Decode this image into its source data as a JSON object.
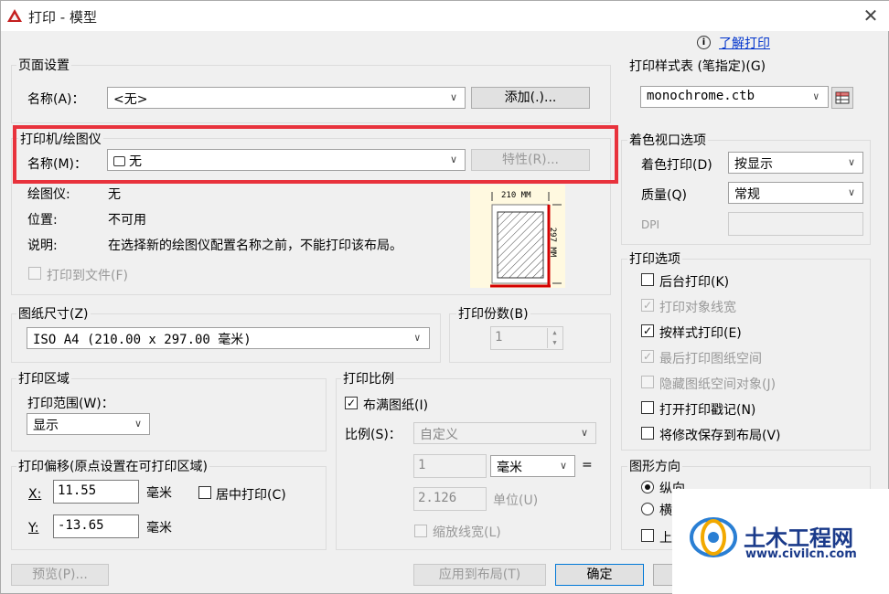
{
  "window": {
    "title": "打印 - 模型",
    "close_glyph": "✕"
  },
  "help": {
    "icon_glyph": "i",
    "link": "了解打印"
  },
  "page_setup": {
    "group": "页面设置",
    "name_label": "名称(A)：",
    "name_value": "<无>",
    "add_button": "添加(.)..."
  },
  "printer": {
    "group": "打印机/绘图仪",
    "name_label": "名称(M)：",
    "name_value": "无",
    "properties_button": "特性(R)...",
    "plotter_label": "绘图仪:",
    "plotter_value": "无",
    "location_label": "位置:",
    "location_value": "不可用",
    "description_label": "说明:",
    "description_value": "在选择新的绘图仪配置名称之前，不能打印该布局。",
    "print_to_file": "打印到文件(F)",
    "preview_width": "210 MM",
    "preview_height": "297 MM"
  },
  "paper_size": {
    "group": "图纸尺寸(Z)",
    "value": "ISO A4 (210.00 x 297.00 毫米)"
  },
  "copies": {
    "group": "打印份数(B)",
    "value": "1"
  },
  "print_area": {
    "group": "打印区域",
    "range_label": "打印范围(W)：",
    "range_value": "显示"
  },
  "print_offset": {
    "group": "打印偏移(原点设置在可打印区域)",
    "x_label": "X:",
    "x_value": "11.55",
    "x_unit": "毫米",
    "y_label": "Y:",
    "y_value": "-13.65",
    "y_unit": "毫米",
    "center_label": "居中打印(C)"
  },
  "print_scale": {
    "group": "打印比例",
    "fit_label": "布满图纸(I)",
    "scale_label": "比例(S)：",
    "scale_value": "自定义",
    "value1": "1",
    "unit_value": "毫米",
    "equals": "=",
    "value2": "2.126",
    "unit_label": "单位(U)",
    "lineweight_label": "缩放线宽(L)"
  },
  "plot_style": {
    "group": "打印样式表 (笔指定)(G)",
    "value": "monochrome.ctb"
  },
  "shaded_viewport": {
    "group": "着色视口选项",
    "shade_label": "着色打印(D)",
    "shade_value": "按显示",
    "quality_label": "质量(Q)",
    "quality_value": "常规",
    "dpi_label": "DPI"
  },
  "plot_options": {
    "group": "打印选项",
    "items": [
      {
        "label": "后台打印(K)",
        "checked": false,
        "disabled": false
      },
      {
        "label": "打印对象线宽",
        "checked": true,
        "disabled": true
      },
      {
        "label": "按样式打印(E)",
        "checked": true,
        "disabled": false
      },
      {
        "label": "最后打印图纸空间",
        "checked": true,
        "disabled": true
      },
      {
        "label": "隐藏图纸空间对象(J)",
        "checked": false,
        "disabled": true
      },
      {
        "label": "打开打印戳记(N)",
        "checked": false,
        "disabled": false
      },
      {
        "label": "将修改保存到布局(V)",
        "checked": false,
        "disabled": false
      }
    ]
  },
  "orientation": {
    "group": "图形方向",
    "portrait": "纵向",
    "landscape": "横",
    "upside_down": "上"
  },
  "footer": {
    "preview": "预览(P)...",
    "apply": "应用到布局(T)",
    "ok": "确定"
  },
  "watermark": {
    "brand": "土木工程网",
    "url": "www.civilcn.com"
  },
  "colors": {
    "highlight": "#e8323c",
    "paper_edge": "#d40000",
    "link": "#0033cc"
  }
}
